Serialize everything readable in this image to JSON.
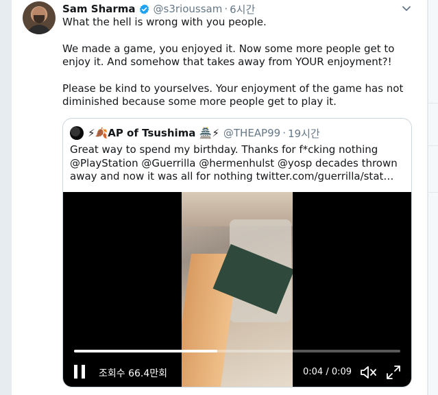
{
  "tweet": {
    "author_name": "Sam Sharma",
    "author_handle": "@s3rioussam",
    "separator": "·",
    "time": "6시간",
    "paragraphs": [
      "What the hell is wrong with you people.",
      "We made a game, you enjoyed it. Now some more people get to enjoy it. And somehow that takes away from YOUR enjoyment?!",
      "Please be kind to yourselves. Your enjoyment of the game has not diminished because some more people get to play it."
    ]
  },
  "quote": {
    "author_name": "⚡🍂AP of Tsushima 🏯⚡",
    "author_handle": "@THEAP99",
    "separator": "·",
    "time": "19시간",
    "text": "Great way to spend my birthday. Thanks for f*cking nothing @PlayStation @Guerrilla @hermenhulst @yosp decades thrown away and now it was all for nothing twitter.com/guerrilla/stat…",
    "video": {
      "views": "조회수 66.4만회",
      "time_display": "0:04 / 0:09",
      "progress_fraction": 0.44
    }
  },
  "colors": {
    "accent": "#1da1f2",
    "secondary_text": "#657786",
    "border": "#ccd6dd"
  },
  "icons": {
    "verified": "verified-badge-icon",
    "caret": "chevron-down-icon",
    "pause": "pause-icon",
    "mute": "volume-muted-icon",
    "fullscreen": "fullscreen-icon"
  }
}
